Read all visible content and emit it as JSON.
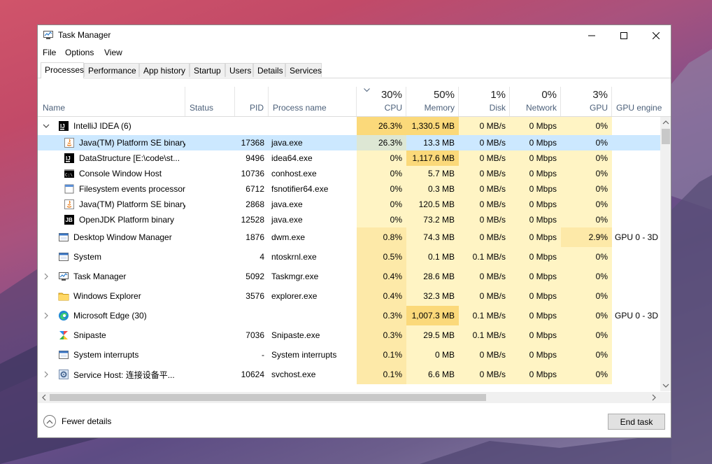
{
  "window": {
    "title": "Task Manager",
    "controls": [
      "minimize",
      "maximize",
      "close"
    ]
  },
  "menu": [
    "File",
    "Options",
    "View"
  ],
  "tabs": [
    {
      "label": "Processes",
      "active": true
    },
    {
      "label": "Performance",
      "active": false
    },
    {
      "label": "App history",
      "active": false
    },
    {
      "label": "Startup",
      "active": false
    },
    {
      "label": "Users",
      "active": false
    },
    {
      "label": "Details",
      "active": false
    },
    {
      "label": "Services",
      "active": false
    }
  ],
  "columns": {
    "name": "Name",
    "status": "Status",
    "pid": "PID",
    "process_name": "Process name",
    "cpu": {
      "pct": "30%",
      "label": "CPU"
    },
    "memory": {
      "pct": "50%",
      "label": "Memory"
    },
    "disk": {
      "pct": "1%",
      "label": "Disk"
    },
    "network": {
      "pct": "0%",
      "label": "Network"
    },
    "gpu": {
      "pct": "3%",
      "label": "GPU"
    },
    "gpu_engine": "GPU engine"
  },
  "rows": [
    {
      "name": "IntelliJ IDEA (6)",
      "icon": "intellij-icon",
      "expander": "expanded",
      "child": false,
      "pid": "",
      "process": "",
      "cpu": "26.3%",
      "memory": "1,330.5 MB",
      "disk": "0 MB/s",
      "network": "0 Mbps",
      "gpu": "0%",
      "gpu_engine": "",
      "selected": false
    },
    {
      "name": "Java(TM) Platform SE binary",
      "icon": "java-icon",
      "expander": "",
      "child": true,
      "pid": "17368",
      "process": "java.exe",
      "cpu": "26.3%",
      "memory": "13.3 MB",
      "disk": "0 MB/s",
      "network": "0 Mbps",
      "gpu": "0%",
      "gpu_engine": "",
      "selected": true
    },
    {
      "name": "DataStructure [E:\\code\\st...",
      "icon": "intellij-icon",
      "expander": "",
      "child": true,
      "pid": "9496",
      "process": "idea64.exe",
      "cpu": "0%",
      "memory": "1,117.6 MB",
      "disk": "0 MB/s",
      "network": "0 Mbps",
      "gpu": "0%",
      "gpu_engine": "",
      "selected": false
    },
    {
      "name": "Console Window Host",
      "icon": "console-icon",
      "expander": "",
      "child": true,
      "pid": "10736",
      "process": "conhost.exe",
      "cpu": "0%",
      "memory": "5.7 MB",
      "disk": "0 MB/s",
      "network": "0 Mbps",
      "gpu": "0%",
      "gpu_engine": "",
      "selected": false
    },
    {
      "name": "Filesystem events processor",
      "icon": "blank-app-icon",
      "expander": "",
      "child": true,
      "pid": "6712",
      "process": "fsnotifier64.exe",
      "cpu": "0%",
      "memory": "0.3 MB",
      "disk": "0 MB/s",
      "network": "0 Mbps",
      "gpu": "0%",
      "gpu_engine": "",
      "selected": false
    },
    {
      "name": "Java(TM) Platform SE binary",
      "icon": "java-icon",
      "expander": "",
      "child": true,
      "pid": "2868",
      "process": "java.exe",
      "cpu": "0%",
      "memory": "120.5 MB",
      "disk": "0 MB/s",
      "network": "0 Mbps",
      "gpu": "0%",
      "gpu_engine": "",
      "selected": false
    },
    {
      "name": "OpenJDK Platform binary",
      "icon": "openjdk-icon",
      "expander": "",
      "child": true,
      "pid": "12528",
      "process": "java.exe",
      "cpu": "0%",
      "memory": "73.2 MB",
      "disk": "0 MB/s",
      "network": "0 Mbps",
      "gpu": "0%",
      "gpu_engine": "",
      "selected": false
    },
    {
      "name": "Desktop Window Manager",
      "icon": "window-app-icon",
      "expander": "",
      "child": false,
      "pid": "1876",
      "process": "dwm.exe",
      "cpu": "0.8%",
      "memory": "74.3 MB",
      "disk": "0 MB/s",
      "network": "0 Mbps",
      "gpu": "2.9%",
      "gpu_engine": "GPU 0 - 3D",
      "selected": false
    },
    {
      "name": "System",
      "icon": "window-app-icon",
      "expander": "",
      "child": false,
      "pid": "4",
      "process": "ntoskrnl.exe",
      "cpu": "0.5%",
      "memory": "0.1 MB",
      "disk": "0.1 MB/s",
      "network": "0 Mbps",
      "gpu": "0%",
      "gpu_engine": "",
      "selected": false
    },
    {
      "name": "Task Manager",
      "icon": "task-manager-icon",
      "expander": "collapsed",
      "child": false,
      "pid": "5092",
      "process": "Taskmgr.exe",
      "cpu": "0.4%",
      "memory": "28.6 MB",
      "disk": "0 MB/s",
      "network": "0 Mbps",
      "gpu": "0%",
      "gpu_engine": "",
      "selected": false
    },
    {
      "name": "Windows Explorer",
      "icon": "folder-icon",
      "expander": "",
      "child": false,
      "pid": "3576",
      "process": "explorer.exe",
      "cpu": "0.4%",
      "memory": "32.3 MB",
      "disk": "0 MB/s",
      "network": "0 Mbps",
      "gpu": "0%",
      "gpu_engine": "",
      "selected": false
    },
    {
      "name": "Microsoft Edge (30)",
      "icon": "edge-icon",
      "expander": "collapsed",
      "child": false,
      "pid": "",
      "process": "",
      "cpu": "0.3%",
      "memory": "1,007.3 MB",
      "disk": "0.1 MB/s",
      "network": "0 Mbps",
      "gpu": "0%",
      "gpu_engine": "GPU 0 - 3D",
      "selected": false
    },
    {
      "name": "Snipaste",
      "icon": "snipaste-icon",
      "expander": "",
      "child": false,
      "pid": "7036",
      "process": "Snipaste.exe",
      "cpu": "0.3%",
      "memory": "29.5 MB",
      "disk": "0.1 MB/s",
      "network": "0 Mbps",
      "gpu": "0%",
      "gpu_engine": "",
      "selected": false
    },
    {
      "name": "System interrupts",
      "icon": "window-app-icon",
      "expander": "",
      "child": false,
      "pid": "-",
      "process": "System interrupts",
      "cpu": "0.1%",
      "memory": "0 MB",
      "disk": "0 MB/s",
      "network": "0 Mbps",
      "gpu": "0%",
      "gpu_engine": "",
      "selected": false
    },
    {
      "name": "Service Host: 连接设备平...",
      "icon": "gear-app-icon",
      "expander": "collapsed",
      "child": false,
      "pid": "10624",
      "process": "svchost.exe",
      "cpu": "0.1%",
      "memory": "6.6 MB",
      "disk": "0 MB/s",
      "network": "0 Mbps",
      "gpu": "0%",
      "gpu_engine": "",
      "selected": false
    }
  ],
  "footer": {
    "fewer_details": "Fewer details",
    "end_task": "End task"
  },
  "colors": {
    "heat_strong": "#fbd97a",
    "heat_medium": "#fde9a8",
    "heat_light": "#fff4c4",
    "selection": "#cce8ff",
    "header_text": "#4c607a"
  }
}
